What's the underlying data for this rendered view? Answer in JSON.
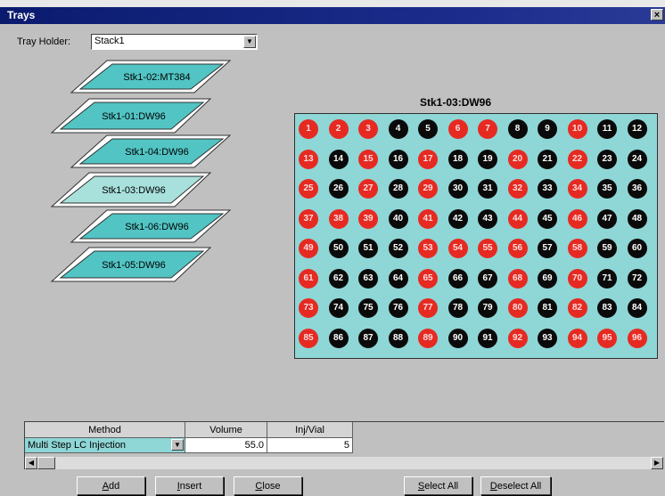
{
  "window": {
    "title": "Trays",
    "close_glyph": "×"
  },
  "tray_holder": {
    "label": "Tray Holder:",
    "value": "Stack1"
  },
  "stack": {
    "trays": [
      {
        "label": "Stk1-02:MT384"
      },
      {
        "label": "Stk1-01:DW96"
      },
      {
        "label": "Stk1-04:DW96"
      },
      {
        "label": "Stk1-03:DW96"
      },
      {
        "label": "Stk1-06:DW96"
      },
      {
        "label": "Stk1-05:DW96"
      }
    ]
  },
  "plate": {
    "title": "Stk1-03:DW96",
    "rows": 8,
    "cols": 12,
    "selected_wells": [
      1,
      2,
      3,
      6,
      7,
      10,
      13,
      15,
      17,
      20,
      22,
      25,
      27,
      29,
      32,
      34,
      37,
      38,
      39,
      41,
      44,
      46,
      49,
      53,
      54,
      55,
      56,
      58,
      61,
      65,
      68,
      70,
      73,
      77,
      80,
      82,
      85,
      89,
      92,
      94,
      95,
      96
    ],
    "colors": {
      "selected": "#e62a22",
      "unselected": "#0a0a0a",
      "plate_bg": "#8fd6d6"
    }
  },
  "method_grid": {
    "headers": [
      "Method",
      "Volume",
      "Inj/Vial"
    ],
    "row": {
      "method": "Multi Step LC Injection",
      "volume": "55.0",
      "inj_per_vial": "5"
    }
  },
  "buttons": {
    "add": {
      "first": "A",
      "rest": "dd"
    },
    "insert": {
      "first": "I",
      "rest": "nsert"
    },
    "close": {
      "first": "C",
      "rest": "lose"
    },
    "select_all": {
      "first": "S",
      "rest": "elect All"
    },
    "deselect_all": {
      "first": "D",
      "rest": "eselect All"
    }
  },
  "colors": {
    "titlebar": "#0a1b6e",
    "tray_fill": "#52c4c4",
    "tray_fill_active": "#a8e0dc"
  }
}
